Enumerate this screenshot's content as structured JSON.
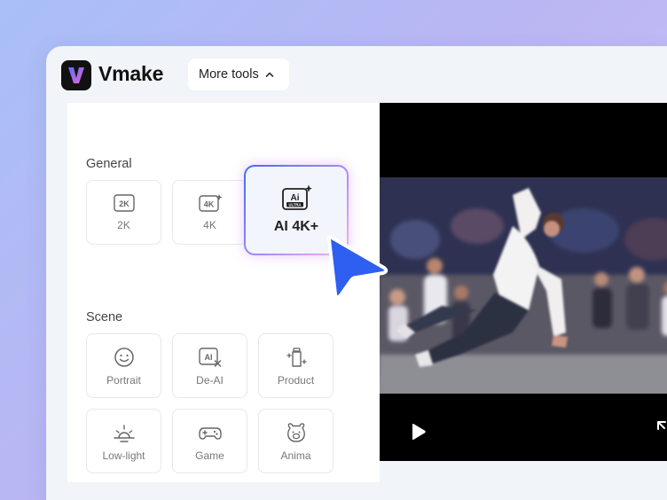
{
  "brand": {
    "name": "Vmake",
    "logo_letter": "V",
    "logo_icon": "vmake-logo-icon"
  },
  "header": {
    "more_tools_label": "More tools",
    "more_tools_icon": "chevron-up-icon"
  },
  "sections": {
    "general": {
      "title": "General",
      "items": [
        {
          "label": "2K",
          "icon": "2k-icon",
          "icon_text": "2K"
        },
        {
          "label": "4K",
          "icon": "4k-sparkle-icon",
          "icon_text": "4K"
        },
        {
          "label": "AI 4K+",
          "icon": "ai-ultra-icon",
          "icon_text": "Ai",
          "icon_subtext": "ULTRA",
          "selected": true
        }
      ]
    },
    "scene": {
      "title": "Scene",
      "items": [
        {
          "label": "Portrait",
          "icon": "smiley-face-icon"
        },
        {
          "label": "De-AI",
          "icon": "de-ai-icon",
          "icon_text": "AI"
        },
        {
          "label": "Product",
          "icon": "product-bottle-icon"
        },
        {
          "label": "Low-light",
          "icon": "sunrise-icon"
        },
        {
          "label": "Game",
          "icon": "gamepad-icon"
        },
        {
          "label": "Anima",
          "icon": "bear-face-icon"
        }
      ]
    }
  },
  "video": {
    "play_icon": "play-icon",
    "expand_icon": "expand-icon"
  },
  "colors": {
    "accent": "#3f6cf0",
    "cursor": "#2f5ff0",
    "brand_gradient": [
      "#5b6cf8",
      "#e86ad8"
    ],
    "selected_gradient": [
      "#3f6cf0",
      "#a88cf5",
      "#f7b3ea"
    ]
  }
}
